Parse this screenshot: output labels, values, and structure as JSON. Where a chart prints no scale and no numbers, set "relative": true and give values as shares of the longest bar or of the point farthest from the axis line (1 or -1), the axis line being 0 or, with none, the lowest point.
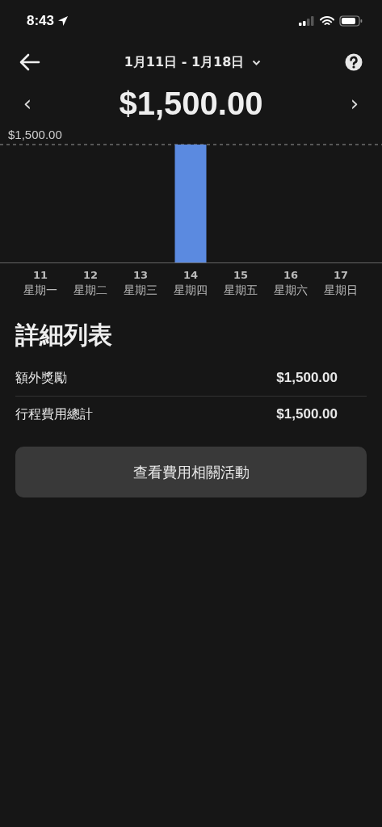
{
  "status_bar": {
    "time": "8:43"
  },
  "header": {
    "date_range": "1月11日 - 1月18日"
  },
  "summary": {
    "prev": "‹",
    "total": "$1,500.00",
    "next": "›"
  },
  "chart": {
    "chart_data": {
      "type": "bar",
      "categories": [
        "11",
        "12",
        "13",
        "14",
        "15",
        "16",
        "17"
      ],
      "values": [
        0,
        0,
        0,
        1,
        0,
        0,
        0
      ],
      "relative": true,
      "annotations": [
        "$1,500.00"
      ]
    },
    "weekdays": [
      "星期一",
      "星期二",
      "星期三",
      "星期四",
      "星期五",
      "星期六",
      "星期日"
    ]
  },
  "breakdown": {
    "title": "詳細列表",
    "rows": [
      {
        "label": "額外獎勵",
        "amount": "$1,500.00"
      },
      {
        "label": "行程費用總計",
        "amount": "$1,500.00"
      }
    ]
  },
  "button": {
    "label": "查看費用相關活動"
  }
}
